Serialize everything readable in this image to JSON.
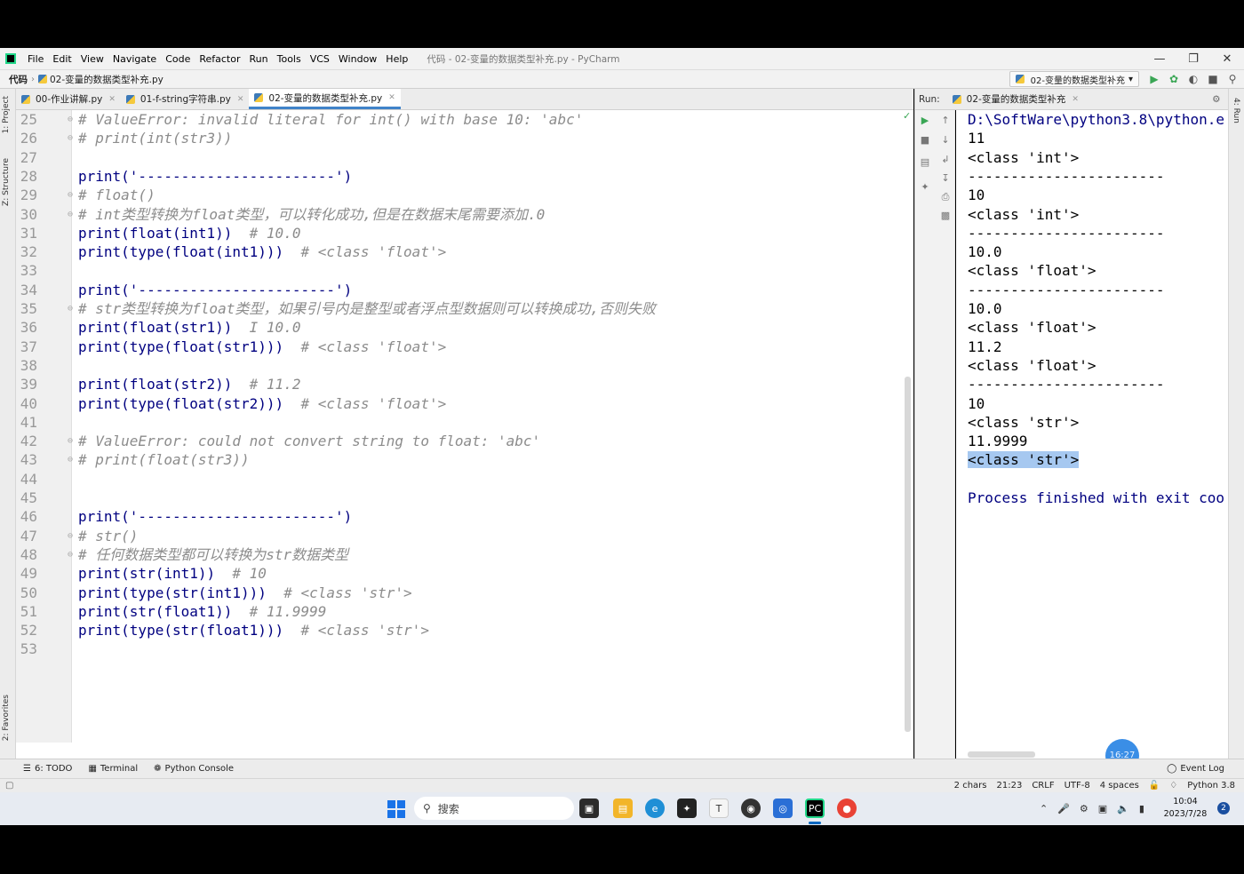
{
  "menu": {
    "items": [
      "File",
      "Edit",
      "View",
      "Navigate",
      "Code",
      "Refactor",
      "Run",
      "Tools",
      "VCS",
      "Window",
      "Help"
    ],
    "window_title": "代码 - 02-变量的数据类型补充.py - PyCharm"
  },
  "navbar": {
    "root": "代码",
    "file": "02-变量的数据类型补充.py",
    "run_config": "02-变量的数据类型补充"
  },
  "left_stripe": {
    "project": "1: Project",
    "structure": "Z: Structure",
    "favorites": "2: Favorites"
  },
  "right_stripe": {
    "run": "4: Run"
  },
  "tabs": [
    {
      "label": "00-作业讲解.py"
    },
    {
      "label": "01-f-string字符串.py"
    },
    {
      "label": "02-变量的数据类型补充.py"
    }
  ],
  "code": [
    {
      "n": "25",
      "t": "# ValueError: invalid literal for int() with base 10: 'abc'",
      "k": "cmt"
    },
    {
      "n": "26",
      "t": "# print(int(str3))",
      "k": "cmt"
    },
    {
      "n": "27",
      "t": "",
      "k": "code"
    },
    {
      "n": "28",
      "t": "print('-----------------------')",
      "k": "code"
    },
    {
      "n": "29",
      "t": "# float()",
      "k": "cmt"
    },
    {
      "n": "30",
      "t": "# int类型转换为float类型，可以转化成功,但是在数据末尾需要添加.0",
      "k": "cmt"
    },
    {
      "n": "31",
      "t": "print(float(int1))",
      "c": "  # 10.0",
      "k": "code"
    },
    {
      "n": "32",
      "t": "print(type(float(int1)))",
      "c": "  # <class 'float'>",
      "k": "code"
    },
    {
      "n": "33",
      "t": "",
      "k": "code"
    },
    {
      "n": "34",
      "t": "print('-----------------------')",
      "k": "code"
    },
    {
      "n": "35",
      "t": "# str类型转换为float类型，如果引号内是整型或者浮点型数据则可以转换成功,否则失败",
      "k": "cmt"
    },
    {
      "n": "36",
      "t": "print(float(str1))",
      "c": "  I 10.0",
      "k": "code"
    },
    {
      "n": "37",
      "t": "print(type(float(str1)))",
      "c": "  # <class 'float'>",
      "k": "code"
    },
    {
      "n": "38",
      "t": "",
      "k": "code"
    },
    {
      "n": "39",
      "t": "print(float(str2))",
      "c": "  # 11.2",
      "k": "code"
    },
    {
      "n": "40",
      "t": "print(type(float(str2)))",
      "c": "  # <class 'float'>",
      "k": "code"
    },
    {
      "n": "41",
      "t": "",
      "k": "code"
    },
    {
      "n": "42",
      "t": "# ValueError: could not convert string to float: 'abc'",
      "k": "cmt"
    },
    {
      "n": "43",
      "t": "# print(float(str3))",
      "k": "cmt"
    },
    {
      "n": "44",
      "t": "",
      "k": "code"
    },
    {
      "n": "45",
      "t": "",
      "k": "code"
    },
    {
      "n": "46",
      "t": "print('-----------------------')",
      "k": "code"
    },
    {
      "n": "47",
      "t": "# str()",
      "k": "cmt"
    },
    {
      "n": "48",
      "t": "# 任何数据类型都可以转换为str数据类型",
      "k": "cmt"
    },
    {
      "n": "49",
      "t": "print(str(int1))",
      "c": "  # 10",
      "k": "code"
    },
    {
      "n": "50",
      "t": "print(type(str(int1)))",
      "c": "  # <class 'str'>",
      "k": "code"
    },
    {
      "n": "51",
      "t": "print(str(float1))",
      "c": "  # 11.9999",
      "k": "code"
    },
    {
      "n": "52",
      "t": "print(type(str(float1)))",
      "c": "  # <class 'str'>",
      "k": "code"
    },
    {
      "n": "53",
      "t": "",
      "k": "code"
    }
  ],
  "run": {
    "label": "Run:",
    "tab": "02-变量的数据类型补充",
    "output": [
      {
        "t": "D:\\SoftWare\\python3.8\\python.e",
        "k": "path"
      },
      {
        "t": "11",
        "k": "out"
      },
      {
        "t": "<class 'int'>",
        "k": "out"
      },
      {
        "t": "-----------------------",
        "k": "out"
      },
      {
        "t": "10",
        "k": "out"
      },
      {
        "t": "<class 'int'>",
        "k": "out"
      },
      {
        "t": "-----------------------",
        "k": "out"
      },
      {
        "t": "10.0",
        "k": "out"
      },
      {
        "t": "<class 'float'>",
        "k": "out"
      },
      {
        "t": "-----------------------",
        "k": "out"
      },
      {
        "t": "10.0",
        "k": "out"
      },
      {
        "t": "<class 'float'>",
        "k": "out"
      },
      {
        "t": "11.2",
        "k": "out"
      },
      {
        "t": "<class 'float'>",
        "k": "out"
      },
      {
        "t": "-----------------------",
        "k": "out"
      },
      {
        "t": "10",
        "k": "out"
      },
      {
        "t": "<class 'str'>",
        "k": "out"
      },
      {
        "t": "11.9999",
        "k": "out"
      },
      {
        "t": "<class 'str'>",
        "k": "sel"
      },
      {
        "t": "",
        "k": "out"
      },
      {
        "t": "Process finished with exit coo",
        "k": "done"
      }
    ],
    "badge": "16:27"
  },
  "tool_windows": {
    "todo": "6: TODO",
    "terminal": "Terminal",
    "python_console": "Python Console",
    "event_log": "Event Log"
  },
  "status": {
    "chars": "2 chars",
    "position": "21:23",
    "line_sep": "CRLF",
    "encoding": "UTF-8",
    "indent": "4 spaces",
    "interpreter": "Python 3.8"
  },
  "taskbar": {
    "search_placeholder": "搜索",
    "time": "10:04",
    "date": "2023/7/28",
    "notifications": "2"
  }
}
